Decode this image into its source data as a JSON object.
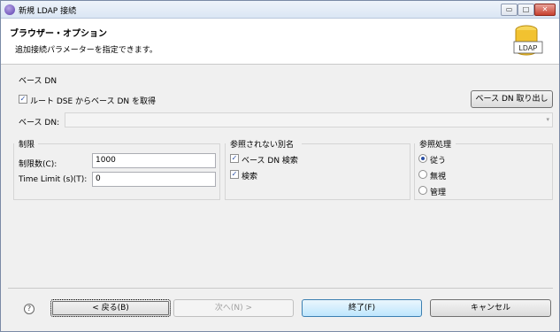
{
  "window": {
    "title": "新規 LDAP 接続",
    "min_symbol": "▭",
    "max_symbol": "□",
    "close_symbol": "✕"
  },
  "header": {
    "title": "ブラウザー・オプション",
    "description": "追加接続パラメーターを指定できます。",
    "icon_label": "LDAP"
  },
  "base_dn": {
    "section_label": "ベース DN",
    "fetch_checkbox_label": "ルート DSE からベース DN を取得",
    "fetch_checked": true,
    "fetch_button_label": "ベース DN 取り出し",
    "field_label": "ベース DN:",
    "field_value": "",
    "dropdown_arrow": "▾"
  },
  "limits": {
    "section_label": "制限",
    "count_limit_label": "制限数(C):",
    "count_limit_value": "1000",
    "time_limit_label": "Time Limit (s)(T):",
    "time_limit_value": "0"
  },
  "aliases": {
    "section_label": "参照されない別名",
    "items": [
      {
        "label": "ベース DN 検索",
        "checked": true
      },
      {
        "label": "検索",
        "checked": true
      }
    ]
  },
  "referrals": {
    "section_label": "参照処理",
    "options": [
      {
        "label": "従う",
        "selected": true
      },
      {
        "label": "無視",
        "selected": false
      },
      {
        "label": "管理",
        "selected": false
      }
    ]
  },
  "footer": {
    "help_symbol": "?",
    "back_label": "< 戻る(B)",
    "next_label": "次へ(N) >",
    "finish_label": "終了(F)",
    "cancel_label": "キャンセル"
  },
  "colors": {
    "accent": "#2a4fa3",
    "title_bar": "#dbe6f4",
    "close_button": "#c7402f",
    "ldap_icon": "#f2c230"
  }
}
